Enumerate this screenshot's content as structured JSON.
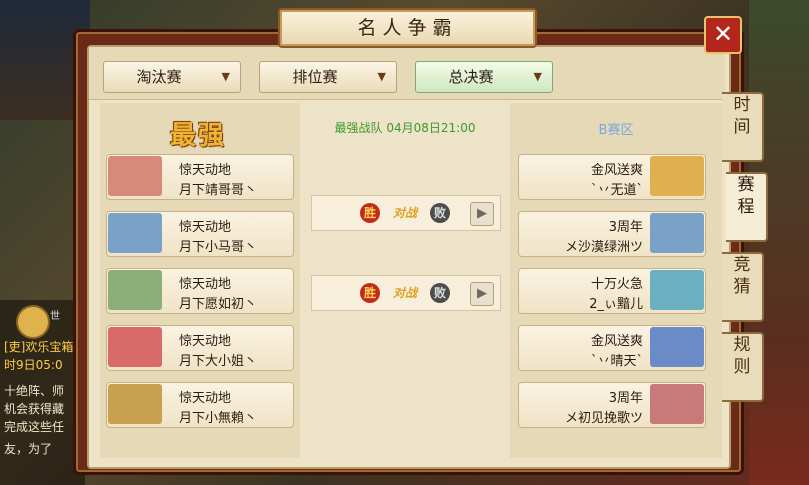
{
  "window": {
    "title": "名人争霸",
    "close_symbol": "✕"
  },
  "tabs_dropdown": [
    {
      "label": "淘汰赛",
      "arrow": "▼"
    },
    {
      "label": "排位赛",
      "arrow": "▼"
    },
    {
      "label": "总决赛",
      "arrow": "▼",
      "active": true
    }
  ],
  "left_column": {
    "heading": "最强",
    "entries": [
      {
        "team": "惊天动地",
        "player": "月下靖哥哥丶",
        "avatar_color": "#d88a7a"
      },
      {
        "team": "惊天动地",
        "player": "月下小马哥丶",
        "avatar_color": "#7aa2c8"
      },
      {
        "team": "惊天动地",
        "player": "月下愿如初丶",
        "avatar_color": "#8cae7a"
      },
      {
        "team": "惊天动地",
        "player": "月下大小姐丶",
        "avatar_color": "#d86a6a"
      },
      {
        "team": "惊天动地",
        "player": "月下小無賴丶",
        "avatar_color": "#c8a050"
      }
    ]
  },
  "middle_column": {
    "info": "最强战队 04月08日21:00",
    "matches": [
      {
        "win": "胜",
        "vs": "对战",
        "lose": "败",
        "video_icon": "▶"
      },
      {
        "win": "胜",
        "vs": "对战",
        "lose": "败",
        "video_icon": "▶"
      }
    ]
  },
  "right_column": {
    "zone": "B赛区",
    "entries": [
      {
        "team": "金风送爽",
        "player": "`丷无道`",
        "avatar_color": "#e0b050"
      },
      {
        "team": "3周年",
        "player": "メ沙漠绿洲ツ",
        "avatar_color": "#7aa2c8"
      },
      {
        "team": "十万火急",
        "player": "2_ぃ黯儿",
        "avatar_color": "#6ab0c0"
      },
      {
        "team": "金风送爽",
        "player": "`丷晴天`",
        "avatar_color": "#6a8ac8"
      },
      {
        "team": "3周年",
        "player": "メ初见挽歌ツ",
        "avatar_color": "#c87a7a"
      }
    ]
  },
  "side_tabs": [
    {
      "label_top": "时",
      "label_bottom": "间"
    },
    {
      "label_top": "赛",
      "label_bottom": "程",
      "active": true
    },
    {
      "label_top": "竞",
      "label_bottom": "猜"
    },
    {
      "label_top": "规",
      "label_bottom": "则"
    }
  ],
  "chat": {
    "lines": [
      "[吏]欢乐宝箱",
      "时9日05:0",
      "  十绝阵、师",
      "机会获得藏",
      "完成这些任",
      "友，为了"
    ],
    "mic_label": "世"
  }
}
